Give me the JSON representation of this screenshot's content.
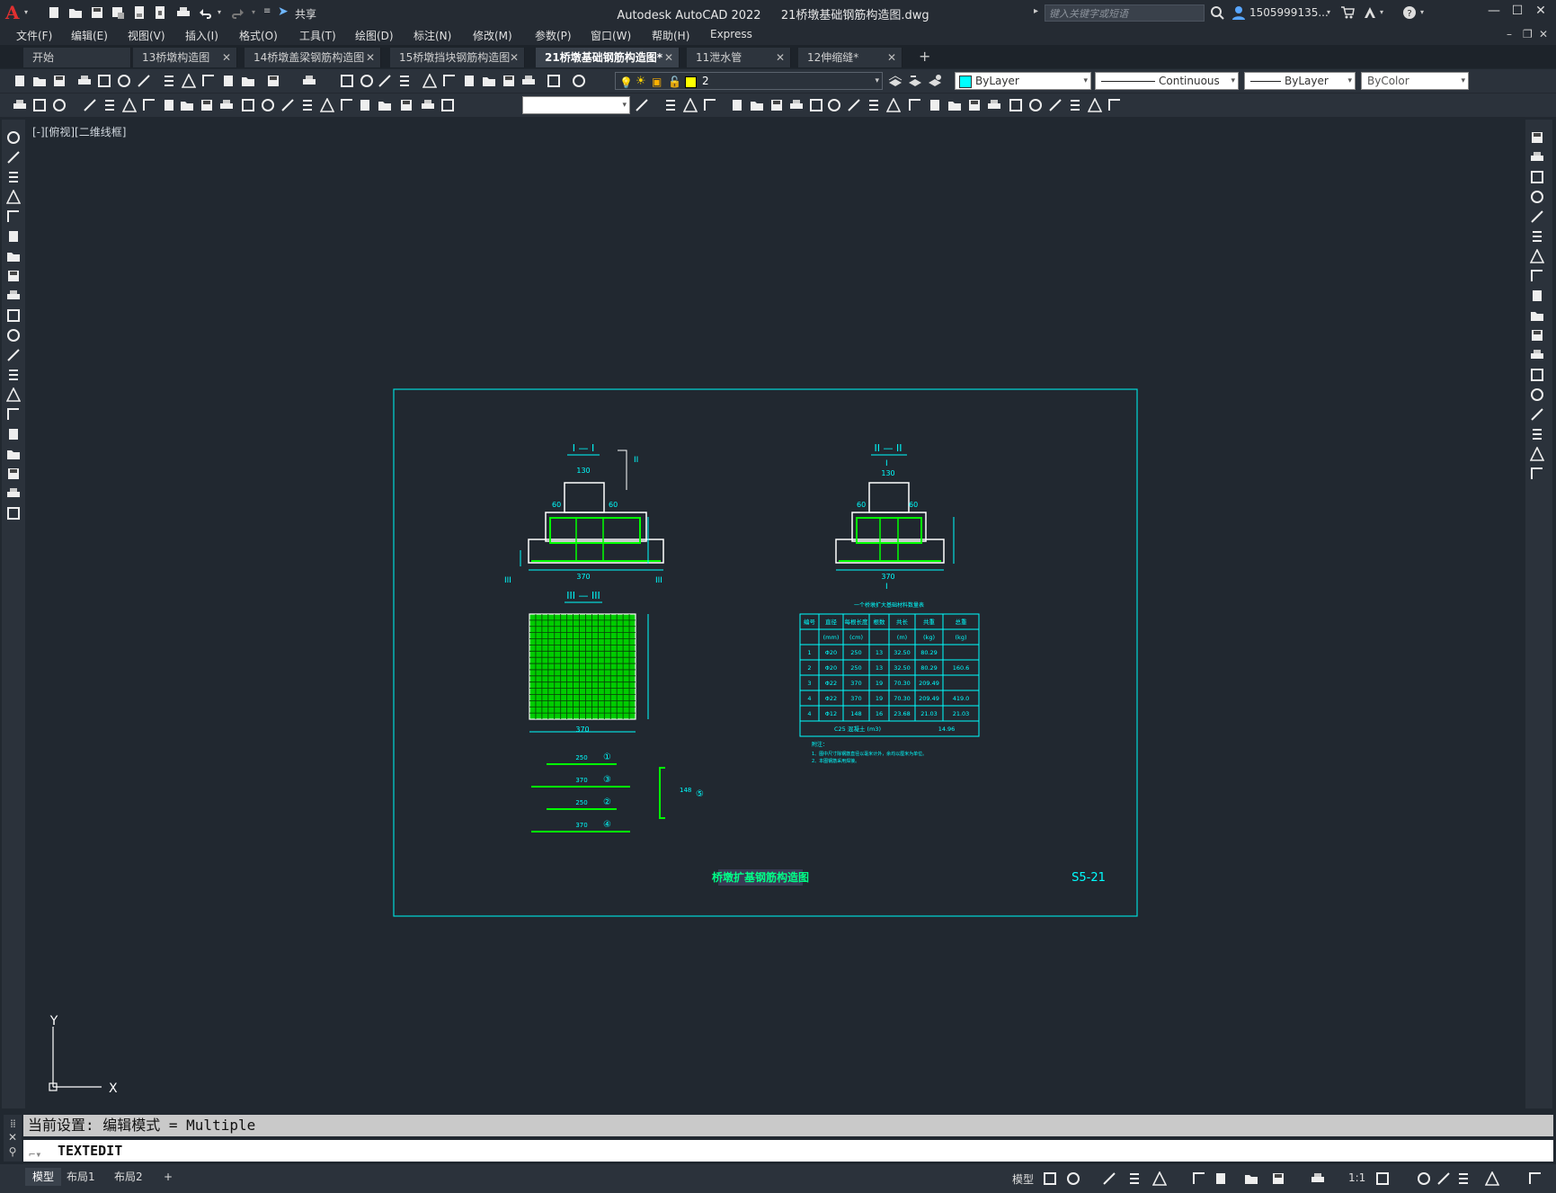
{
  "window": {
    "app_title": "Autodesk AutoCAD 2022",
    "file_title": "21桥墩基础钢筋构造图.dwg",
    "share_label": "共享",
    "search_placeholder": "键入关键字或短语",
    "user_label": "1505999135...",
    "minimize": "—",
    "maximize": "☐",
    "close": "✕"
  },
  "menu": [
    "文件(F)",
    "编辑(E)",
    "视图(V)",
    "插入(I)",
    "格式(O)",
    "工具(T)",
    "绘图(D)",
    "标注(N)",
    "修改(M)",
    "参数(P)",
    "窗口(W)",
    "帮助(H)",
    "Express"
  ],
  "tabs": [
    {
      "label": "开始",
      "closable": false
    },
    {
      "label": "13桥墩构造图",
      "closable": true
    },
    {
      "label": "14桥墩盖梁钢筋构造图",
      "closable": true
    },
    {
      "label": "15桥墩挡块钢筋构造图",
      "closable": true
    },
    {
      "label": "21桥墩基础钢筋构造图*",
      "closable": true,
      "active": true
    },
    {
      "label": "11泄水管",
      "closable": true
    },
    {
      "label": "12伸缩缝*",
      "closable": true
    }
  ],
  "tab_close_glyph": "✕",
  "new_tab_glyph": "+",
  "properties": {
    "layer_value": "2",
    "color_value": "ByLayer",
    "color_swatch": "#00ffff",
    "layer_swatch": "#ffff00",
    "linetype_value": "Continuous",
    "lineweight_value": "ByLayer",
    "plotstyle_value": "ByColor"
  },
  "canvas": {
    "view_label": "[-][俯视][二维线框]",
    "ucs_x": "X",
    "ucs_y": "Y"
  },
  "drawing": {
    "section_1": "I — I",
    "section_2": "II — II",
    "section_3": "III — III",
    "cut_mark_1": "I",
    "cut_mark_2": "II",
    "cut_mark_3": "III",
    "dim_130": "130",
    "dim_60": "60",
    "dim_370": "370",
    "title_block": "桥墩扩基钢筋构造图",
    "sheet_no": "S5-21",
    "table_title": "一个桥墩扩大基础材料数量表",
    "table_headers": [
      "编号",
      "直径",
      "每根长度",
      "根数",
      "共长",
      "共重",
      "总重"
    ],
    "table_units": [
      "",
      "(mm)",
      "(cm)",
      "",
      "(m)",
      "(kg)",
      "(kg)"
    ],
    "table_rows": [
      [
        "1",
        "Φ20",
        "250",
        "13",
        "32.50",
        "80.29"
      ],
      [
        "2",
        "Φ20",
        "250",
        "13",
        "32.50",
        "80.29"
      ],
      [
        "3",
        "Φ22",
        "370",
        "19",
        "70.30",
        "209.49"
      ],
      [
        "4",
        "Φ22",
        "370",
        "19",
        "70.30",
        "209.49"
      ],
      [
        "4",
        "Φ12",
        "148",
        "16",
        "23.68",
        "21.03"
      ]
    ],
    "table_totals": [
      "160.6",
      "419.0",
      "21.03"
    ],
    "concrete_label": "C25 混凝土 (m3)",
    "concrete_value": "14.96",
    "notes_title": "附注：",
    "notes": [
      "1、图中尺寸除钢筋直径以毫米计外，余均以厘米为单位。",
      "2、本图钢筋采用焊接。"
    ],
    "bar_marks": [
      "①",
      "②",
      "③",
      "④",
      "⑤"
    ],
    "bar_dims": [
      "250",
      "370",
      "250",
      "370",
      "148"
    ]
  },
  "command": {
    "history": "当前设置: 编辑模式 = Multiple",
    "current": "TEXTEDIT",
    "prompt_glyph": "⌐▾"
  },
  "status": {
    "layout_tabs": [
      "模型",
      "布局1",
      "布局2"
    ],
    "add_layout": "+",
    "model_label": "模型",
    "scale_label": "1:1"
  }
}
